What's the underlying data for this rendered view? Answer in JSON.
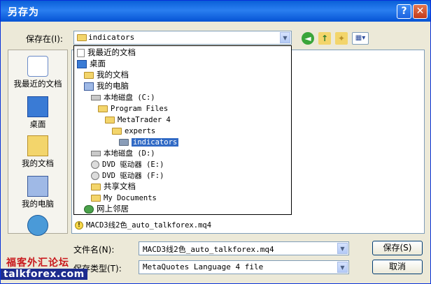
{
  "window": {
    "title": "另存为",
    "help_glyph": "?",
    "close_glyph": "✕"
  },
  "toolbar": {
    "save_in_label": "保存在(I):",
    "save_in_value": "indicators"
  },
  "places": [
    {
      "label": "我最近的文档"
    },
    {
      "label": "桌面"
    },
    {
      "label": "我的文档"
    },
    {
      "label": "我的电脑"
    }
  ],
  "dropdown": {
    "items": [
      {
        "label": "我最近的文档",
        "icon": "recent-icon"
      },
      {
        "label": "桌面",
        "icon": "desktop-icon"
      },
      {
        "label": "我的文档",
        "icon": "documents-icon"
      },
      {
        "label": "我的电脑",
        "icon": "computer-icon"
      },
      {
        "label": "本地磁盘 (C:)",
        "icon": "drive-icon"
      },
      {
        "label": "Program Files",
        "icon": "folder-icon"
      },
      {
        "label": "MetaTrader 4",
        "icon": "folder-icon"
      },
      {
        "label": "experts",
        "icon": "folder-icon"
      },
      {
        "label": "indicators",
        "icon": "folder-icon"
      },
      {
        "label": "本地磁盘 (D:)",
        "icon": "drive-icon"
      },
      {
        "label": "DVD 驱动器 (E:)",
        "icon": "dvd-icon"
      },
      {
        "label": "DVD 驱动器 (F:)",
        "icon": "dvd-icon"
      },
      {
        "label": "共享文档",
        "icon": "folder-icon"
      },
      {
        "label": "My Documents",
        "icon": "folder-icon"
      },
      {
        "label": "网上邻居",
        "icon": "network-icon"
      }
    ],
    "selected": "indicators"
  },
  "filelist": {
    "item": "MACD3线2色_auto_talkforex.mq4"
  },
  "form": {
    "filename_label": "文件名(N):",
    "filename_value": "MACD3线2色_auto_talkforex.mq4",
    "filetype_label": "保存类型(T):",
    "filetype_value": "MetaQuotes Language 4 file"
  },
  "buttons": {
    "save": "保存(S)",
    "cancel": "取消"
  },
  "watermark": {
    "line1": "福客外汇论坛",
    "line2": "talkforex.com"
  }
}
